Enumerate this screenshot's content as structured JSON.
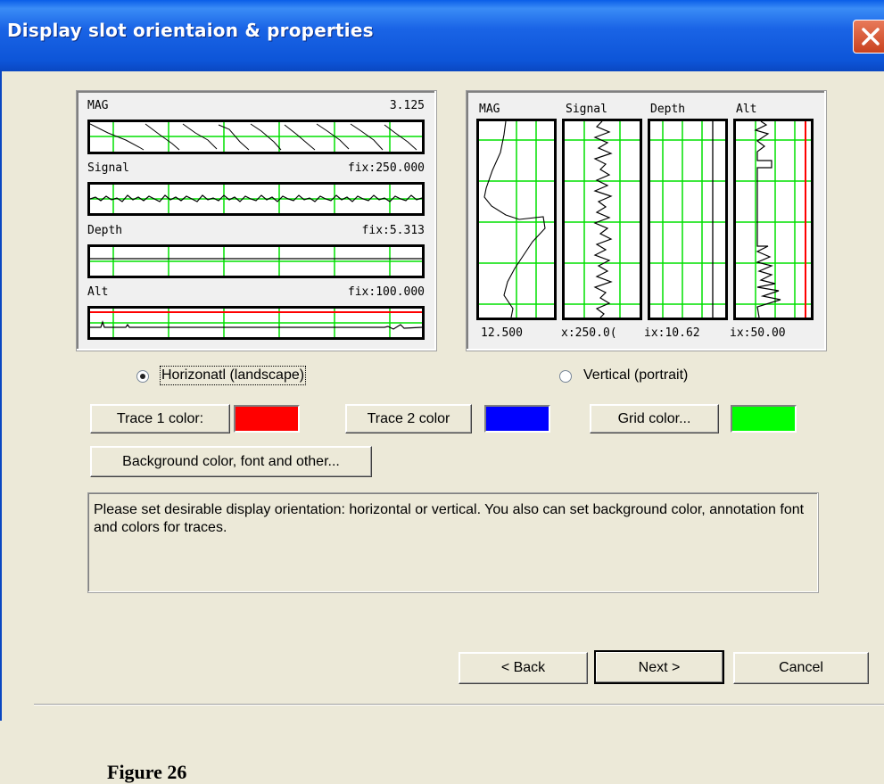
{
  "window": {
    "title": "Display slot orientaion & properties"
  },
  "horizontal_preview": {
    "tracks": [
      {
        "name": "MAG",
        "value": "3.125"
      },
      {
        "name": "Signal",
        "value": "fix:250.000"
      },
      {
        "name": "Depth",
        "value": "fix:5.313"
      },
      {
        "name": "Alt",
        "value": "fix:100.000"
      }
    ]
  },
  "vertical_preview": {
    "headers": [
      "MAG",
      "Signal",
      "Depth",
      "Alt"
    ],
    "footers": [
      "12.500",
      "x:250.0(",
      "ix:10.62",
      "ix:50.00"
    ]
  },
  "orientation": {
    "horizontal_label": "Horizonatl (landscape)",
    "vertical_label": "Vertical (portrait)",
    "selected": "horizontal"
  },
  "buttons": {
    "trace1": "Trace 1 color:",
    "trace2": "Trace 2 color",
    "grid": "Grid color...",
    "background": "Background  color, font and other...",
    "back": "< Back",
    "next": "Next >",
    "cancel": "Cancel"
  },
  "colors": {
    "trace1": "#ff0000",
    "trace2": "#0000ff",
    "grid": "#00ff00"
  },
  "info_text": "Please set desirable display orientation: horizontal or vertical. You also can set background color, annotation font and colors for traces.",
  "caption": "Figure 26"
}
